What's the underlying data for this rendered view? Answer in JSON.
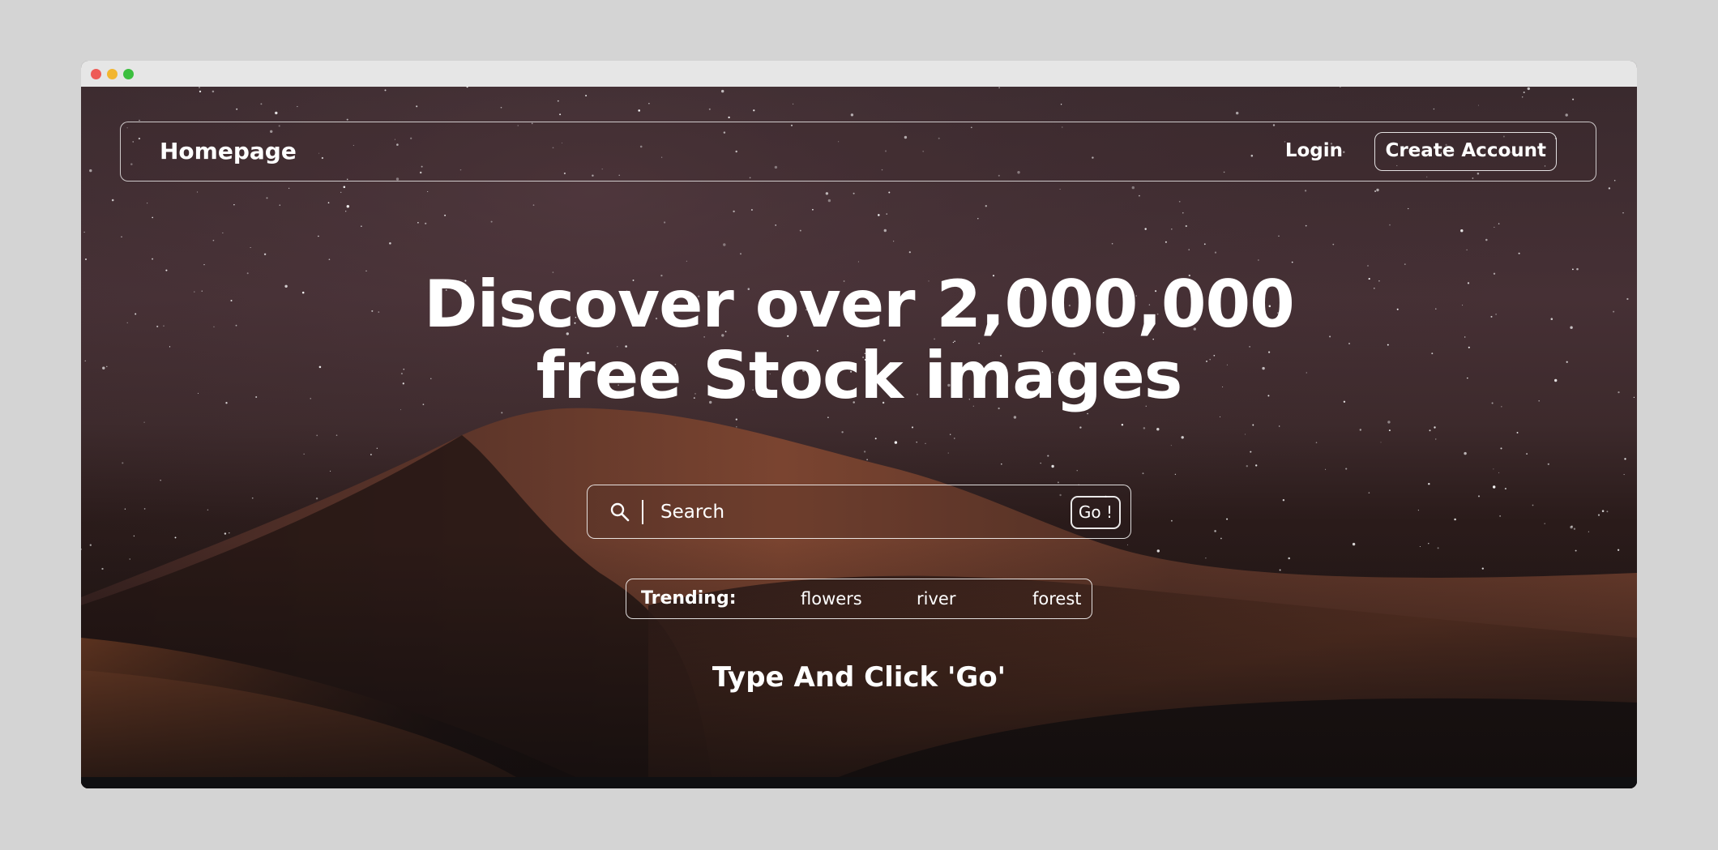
{
  "navbar": {
    "brand": "Homepage",
    "login": "Login",
    "create_account": "Create Account"
  },
  "hero": {
    "line1": "Discover over 2,000,000",
    "line2": "free Stock images"
  },
  "search": {
    "placeholder": "Search",
    "value": "",
    "go_label": "Go !",
    "icon": "search-icon"
  },
  "trending": {
    "label": "Trending:",
    "tags": [
      "flowers",
      "river",
      "forest"
    ]
  },
  "instruction": "Type And Click 'Go'",
  "colors": {
    "sky": "#463035",
    "dune_light": "#8a4a2c",
    "dune_dark": "#1e1514",
    "text": "#ffffff"
  }
}
